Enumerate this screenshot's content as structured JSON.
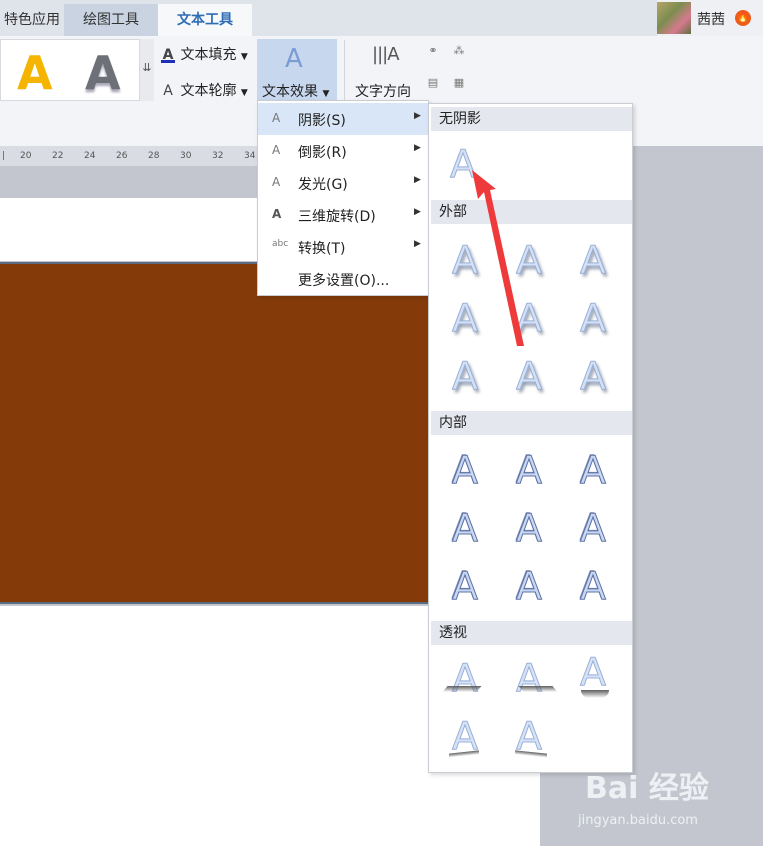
{
  "tabs": [
    {
      "label": "特色应用"
    },
    {
      "label": "绘图工具"
    },
    {
      "label": "文本工具"
    }
  ],
  "user": {
    "name": "茜茜"
  },
  "ribbon": {
    "text_fill": "文本填充",
    "text_outline": "文本轮廓",
    "text_effect": "文本效果",
    "text_direction": "文字方向"
  },
  "ruler_ticks": [
    "20",
    "22",
    "24",
    "26",
    "28",
    "30",
    "32",
    "34"
  ],
  "menu": {
    "items": [
      {
        "label": "阴影(S)",
        "icon": "text-a-icon",
        "submenu": true,
        "highlighted": true
      },
      {
        "label": "倒影(R)",
        "icon": "text-a-icon",
        "submenu": true
      },
      {
        "label": "发光(G)",
        "icon": "text-a-icon",
        "submenu": true
      },
      {
        "label": "三维旋转(D)",
        "icon": "text-a-icon",
        "submenu": true
      },
      {
        "label": "转换(T)",
        "icon": "abc-icon",
        "submenu": true
      },
      {
        "label": "更多设置(O)...",
        "icon": "",
        "submenu": false
      }
    ]
  },
  "shadow_submenu": {
    "sections": {
      "none": "无阴影",
      "outer": "外部",
      "inner": "内部",
      "perspective": "透视"
    },
    "sample_glyph": "A"
  },
  "colors": {
    "accent_tab": "#2f6eb5",
    "document_fill": "#853b09",
    "menu_highlight": "#d9e6f7",
    "arrow": "#ee3a3a"
  },
  "watermark": {
    "brand": "Bai 经验",
    "url": "jingyan.baidu.com"
  }
}
